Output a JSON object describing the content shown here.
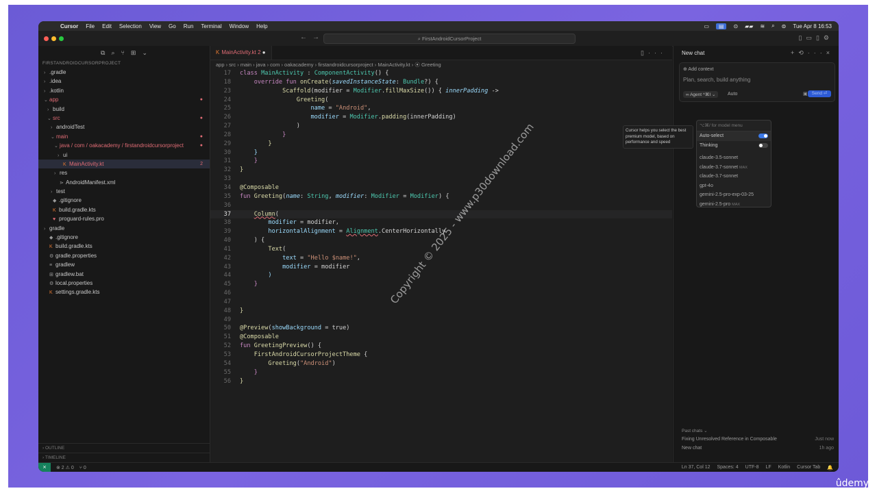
{
  "menubar": {
    "app": "Cursor",
    "items": [
      "File",
      "Edit",
      "Selection",
      "View",
      "Go",
      "Run",
      "Terminal",
      "Window",
      "Help"
    ],
    "clock": "Tue Apr 8  16:53"
  },
  "titlebar": {
    "search": "FirstAndroidCursorProject"
  },
  "sidebar": {
    "title": "FIRSTANDROIDCURSORPROJECT",
    "tree": [
      {
        "label": ".gradle",
        "indent": 0,
        "chev": "›",
        "icon": ""
      },
      {
        "label": ".idea",
        "indent": 0,
        "chev": "›",
        "icon": ""
      },
      {
        "label": ".kotlin",
        "indent": 0,
        "chev": "›",
        "icon": ""
      },
      {
        "label": "app",
        "indent": 0,
        "chev": "⌄",
        "icon": "",
        "red": true,
        "mark": "●"
      },
      {
        "label": "build",
        "indent": 1,
        "chev": "›",
        "icon": ""
      },
      {
        "label": "src",
        "indent": 1,
        "chev": "⌄",
        "icon": "",
        "red": true,
        "mark": "●"
      },
      {
        "label": "androidTest",
        "indent": 2,
        "chev": "›",
        "icon": ""
      },
      {
        "label": "main",
        "indent": 2,
        "chev": "⌄",
        "icon": "",
        "red": true,
        "mark": "●"
      },
      {
        "label": "java / com / oakacademy / firstandroidcursorproject",
        "indent": 3,
        "chev": "⌄",
        "icon": "",
        "red": true,
        "mark": "●"
      },
      {
        "label": "ui",
        "indent": 4,
        "chev": "›",
        "icon": ""
      },
      {
        "label": "MainActivity.kt",
        "indent": 4,
        "chev": "",
        "icon": "K",
        "red": true,
        "sel": true,
        "mark": "2"
      },
      {
        "label": "res",
        "indent": 3,
        "chev": "›",
        "icon": ""
      },
      {
        "label": "AndroidManifest.xml",
        "indent": 3,
        "chev": "",
        "icon": "⋗"
      },
      {
        "label": "test",
        "indent": 2,
        "chev": "›",
        "icon": ""
      },
      {
        "label": ".gitignore",
        "indent": 1,
        "chev": "",
        "icon": "◆"
      },
      {
        "label": "build.gradle.kts",
        "indent": 1,
        "chev": "",
        "icon": "K"
      },
      {
        "label": "proguard-rules.pro",
        "indent": 1,
        "chev": "",
        "icon": "♥"
      },
      {
        "label": "gradle",
        "indent": 0,
        "chev": "›",
        "icon": ""
      },
      {
        "label": ".gitignore",
        "indent": 0,
        "chev": "",
        "icon": "◆"
      },
      {
        "label": "build.gradle.kts",
        "indent": 0,
        "chev": "",
        "icon": "K"
      },
      {
        "label": "gradle.properties",
        "indent": 0,
        "chev": "",
        "icon": "⚙"
      },
      {
        "label": "gradlew",
        "indent": 0,
        "chev": "",
        "icon": "≡"
      },
      {
        "label": "gradlew.bat",
        "indent": 0,
        "chev": "",
        "icon": "⊞"
      },
      {
        "label": "local.properties",
        "indent": 0,
        "chev": "",
        "icon": "⚙"
      },
      {
        "label": "settings.gradle.kts",
        "indent": 0,
        "chev": "",
        "icon": "K"
      }
    ],
    "outline": "OUTLINE",
    "timeline": "TIMELINE"
  },
  "editor": {
    "tab": "MainActivity.kt 2",
    "breadcrumb": "app  ›  src  ›  main  ›  java  ›  com  ›  oakacademy  ›  firstandroidcursorproject  ›  MainActivity.kt  ›  ⦿ Greeting"
  },
  "chat": {
    "title": "New chat",
    "add_context": "⊕ Add context",
    "placeholder": "Plan, search, build anything",
    "agent": "∞ Agent  ^⌘I  ⌄",
    "auto": "Auto",
    "send": "Send ⏎",
    "past_chats_label": "Past chats  ⌄",
    "past_chats": [
      {
        "title": "Fixing Unresolved Reference in Composable",
        "time": "Just now"
      },
      {
        "title": "New chat",
        "time": "1h ago"
      }
    ]
  },
  "model_menu": {
    "search_placeholder": "⌥⌘/ for model menu",
    "tooltip": "Cursor helps you select the best premium model, based on performance and speed",
    "options": [
      {
        "label": "Auto-select",
        "toggle": "on"
      },
      {
        "label": "Thinking",
        "toggle": "off"
      }
    ],
    "models": [
      {
        "label": "claude-3.5-sonnet",
        "max": ""
      },
      {
        "label": "claude-3.7-sonnet",
        "max": "MAX"
      },
      {
        "label": "claude-3.7-sonnet",
        "max": ""
      },
      {
        "label": "gpt-4o",
        "max": ""
      },
      {
        "label": "gemini-2.5-pro-exp-03-25",
        "max": ""
      },
      {
        "label": "gemini-2.5-pro",
        "max": "MAX"
      }
    ]
  },
  "status": {
    "remote": "⨯",
    "problems": "⊗ 2 ⚠ 0",
    "ports": "⑂ 0",
    "right": [
      "Ln 37, Col 12",
      "Spaces: 4",
      "UTF-8",
      "LF",
      "Kotlin",
      "Cursor Tab",
      "🔔"
    ]
  },
  "watermark": "Copyright © 2025 - www.p30download.com",
  "brand": "ûdemy",
  "colors": {
    "accent": "#3b78e7",
    "error": "#e06c75",
    "kotlin": "#e37933"
  }
}
